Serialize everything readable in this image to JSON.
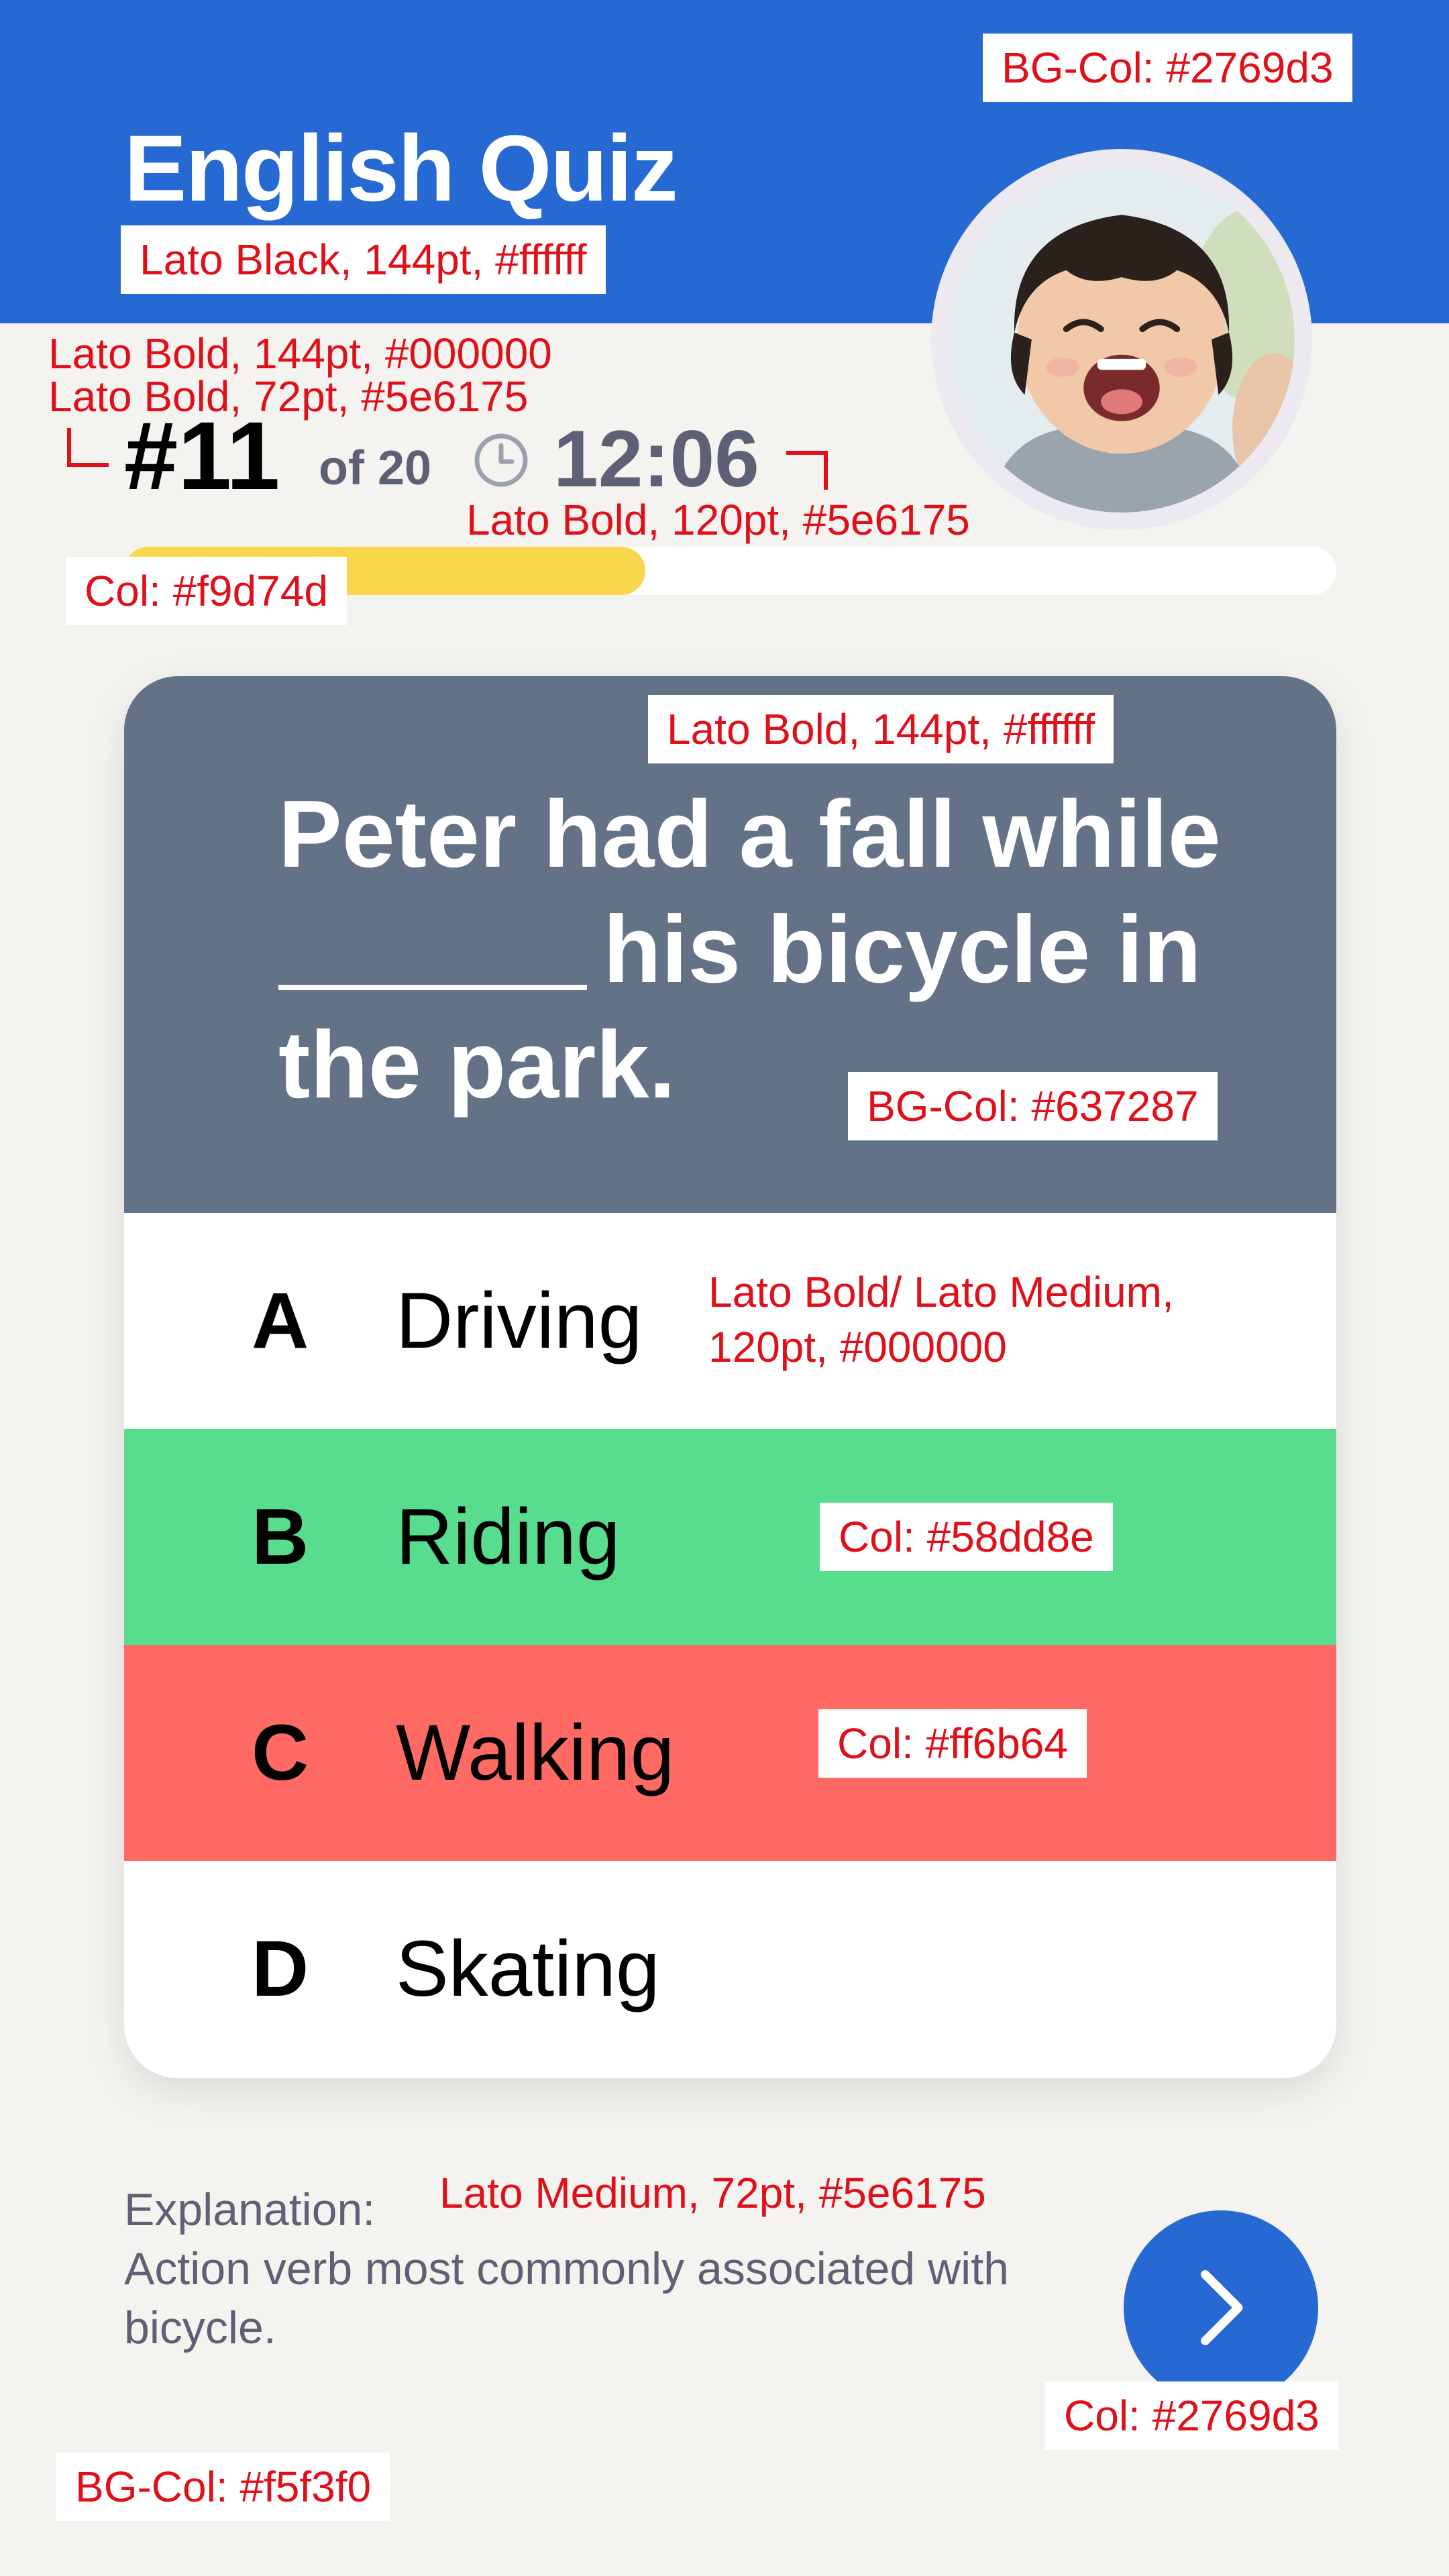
{
  "header": {
    "title": "English Quiz"
  },
  "status": {
    "question_number": "#11",
    "question_total": "of 20",
    "timer": "12:06",
    "progress_fraction": 0.43
  },
  "question": {
    "text_before": "Peter had a fall while",
    "text_after": "his bicycle in the park."
  },
  "options": [
    {
      "letter": "A",
      "text": "Driving",
      "state": "default"
    },
    {
      "letter": "B",
      "text": "Riding",
      "state": "correct"
    },
    {
      "letter": "C",
      "text": "Walking",
      "state": "wrong"
    },
    {
      "letter": "D",
      "text": "Skating",
      "state": "default"
    }
  ],
  "explanation": {
    "label": "Explanation:",
    "text": "Action verb most commonly associated with bicycle."
  },
  "annotations": {
    "header_bg": "BG-Col: #2769d3",
    "title_font": "Lato Black, 144pt, #ffffff",
    "qnum_font": "Lato Bold, 144pt, #000000",
    "qof_font": "Lato Bold, 72pt, #5e6175",
    "timer_font": "Lato Bold, 120pt, #5e6175",
    "progress_col": "Col: #f9d74d",
    "question_font": "Lato Bold, 144pt, #ffffff",
    "question_bg": "BG-Col: #637287",
    "option_font": "Lato Bold/ Lato Medium, 120pt, #000000",
    "correct_col": "Col: #58dd8e",
    "wrong_col": "Col: #ff6b64",
    "explain_font": "Lato Medium, 72pt, #5e6175",
    "button_col": "Col: #2769d3",
    "page_bg": "BG-Col: #f5f3f0"
  },
  "colors": {
    "header": "#2769d3",
    "page": "#f5f3f0",
    "question_bg": "#637287",
    "progress": "#f9d74d",
    "correct": "#58dd8e",
    "wrong": "#ff6b64",
    "text_primary": "#000000",
    "text_secondary": "#5e6175",
    "annotation": "#e0101a"
  },
  "icons": {
    "clock": "clock-icon",
    "next": "chevron-right-icon",
    "avatar": "child-photo"
  }
}
